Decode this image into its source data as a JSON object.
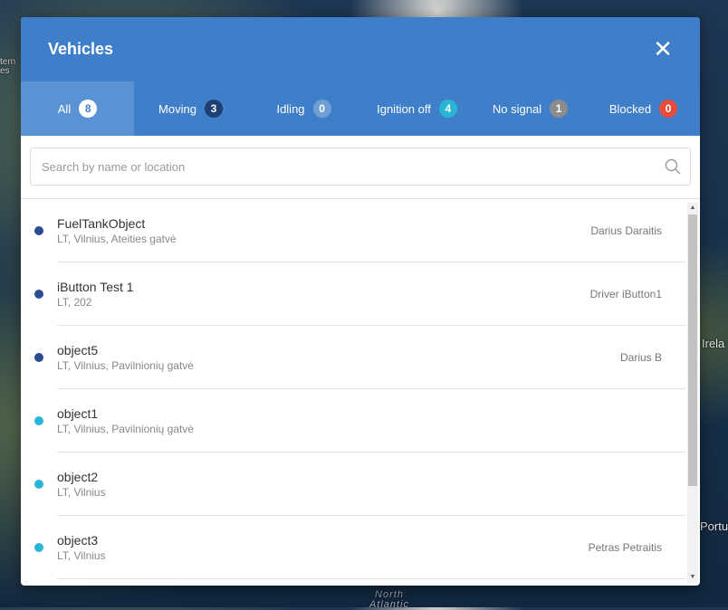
{
  "map": {
    "labels": [
      "Irela",
      "Portu",
      "North Atlantic",
      "tern es"
    ]
  },
  "modal": {
    "title": "Vehicles",
    "close_icon": "close-icon"
  },
  "tabs": [
    {
      "label": "All",
      "count": "8",
      "color": "#ffffff",
      "text_color": "#3f7ec8"
    },
    {
      "label": "Moving",
      "count": "3",
      "color": "#1e3f73",
      "text_color": "#ffffff"
    },
    {
      "label": "Idling",
      "count": "0",
      "color": "#6e9fd6",
      "text_color": "#ffffff"
    },
    {
      "label": "Ignition off",
      "count": "4",
      "color": "#29b6d6",
      "text_color": "#ffffff"
    },
    {
      "label": "No signal",
      "count": "1",
      "color": "#8c8c8c",
      "text_color": "#ffffff"
    },
    {
      "label": "Blocked",
      "count": "0",
      "color": "#e74c3c",
      "text_color": "#ffffff"
    }
  ],
  "search": {
    "placeholder": "Search by name or location",
    "icon": "search-icon"
  },
  "vehicles": [
    {
      "name": "FuelTankObject",
      "location": "LT, Vilnius, Ateities gatvė",
      "driver": "Darius Daraitis",
      "status_color": "#2a4d8f"
    },
    {
      "name": "iButton Test 1",
      "location": "LT, 202",
      "driver": "Driver iButton1",
      "status_color": "#2a4d8f"
    },
    {
      "name": "object5",
      "location": "LT, Vilnius, Pavilnionių gatvė",
      "driver": "Darius B",
      "status_color": "#2a4d8f"
    },
    {
      "name": "object1",
      "location": "LT, Vilnius, Pavilnionių gatvė",
      "driver": "",
      "status_color": "#29b6d6"
    },
    {
      "name": "object2",
      "location": "LT, Vilnius",
      "driver": "",
      "status_color": "#29b6d6"
    },
    {
      "name": "object3",
      "location": "LT, Vilnius",
      "driver": "Petras Petraitis",
      "status_color": "#29b6d6"
    }
  ],
  "colors": {
    "header": "#3f7ec8",
    "active_tab": "#5a93d3"
  }
}
